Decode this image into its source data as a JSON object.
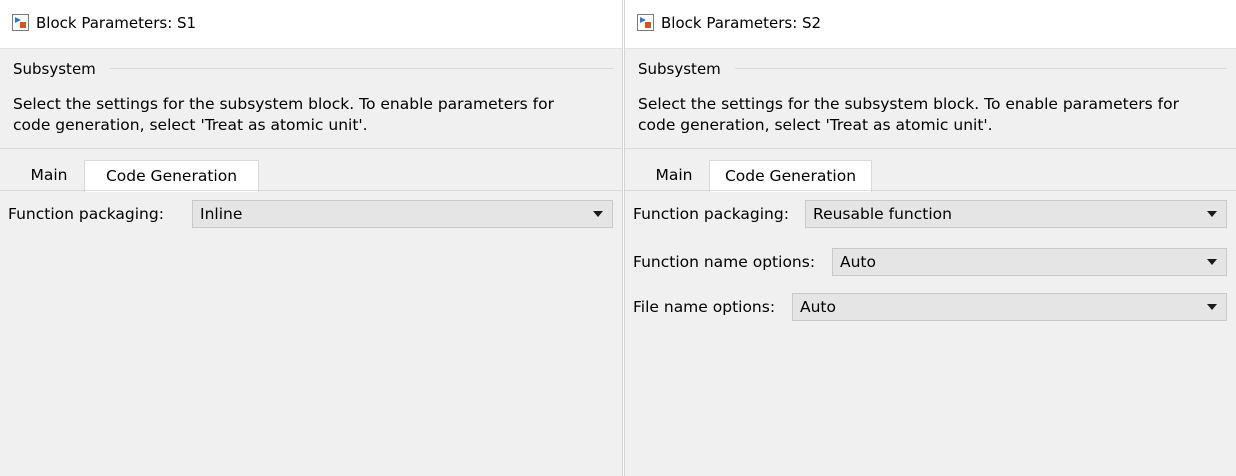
{
  "dialogs": [
    {
      "title": "Block Parameters: S1",
      "icon": "block-parameters-icon",
      "group_label": "Subsystem",
      "description_lines": [
        "Select the settings for the subsystem block. To enable parameters for",
        "code generation, select 'Treat as atomic unit'."
      ],
      "tabs": [
        {
          "label": "Main",
          "active": false
        },
        {
          "label": "Code Generation",
          "active": true
        }
      ],
      "fields": [
        {
          "label": "Function packaging:",
          "value": "Inline"
        }
      ]
    },
    {
      "title": "Block Parameters: S2",
      "icon": "block-parameters-icon",
      "group_label": "Subsystem",
      "description_lines": [
        "Select the settings for the subsystem block. To enable parameters for",
        "code generation, select 'Treat as atomic unit'."
      ],
      "tabs": [
        {
          "label": "Main",
          "active": false
        },
        {
          "label": "Code Generation",
          "active": true
        }
      ],
      "fields": [
        {
          "label": "Function packaging:",
          "value": "Reusable function"
        },
        {
          "label": "Function name options:",
          "value": "Auto"
        },
        {
          "label": "File name options:",
          "value": "Auto"
        }
      ]
    }
  ],
  "colors": {
    "dialog_background": "#f0f0f0",
    "titlebar_background": "#ffffff",
    "combo_background": "#e5e5e5",
    "icon_accent": "#d9531e",
    "icon_blue": "#2f78c4"
  }
}
